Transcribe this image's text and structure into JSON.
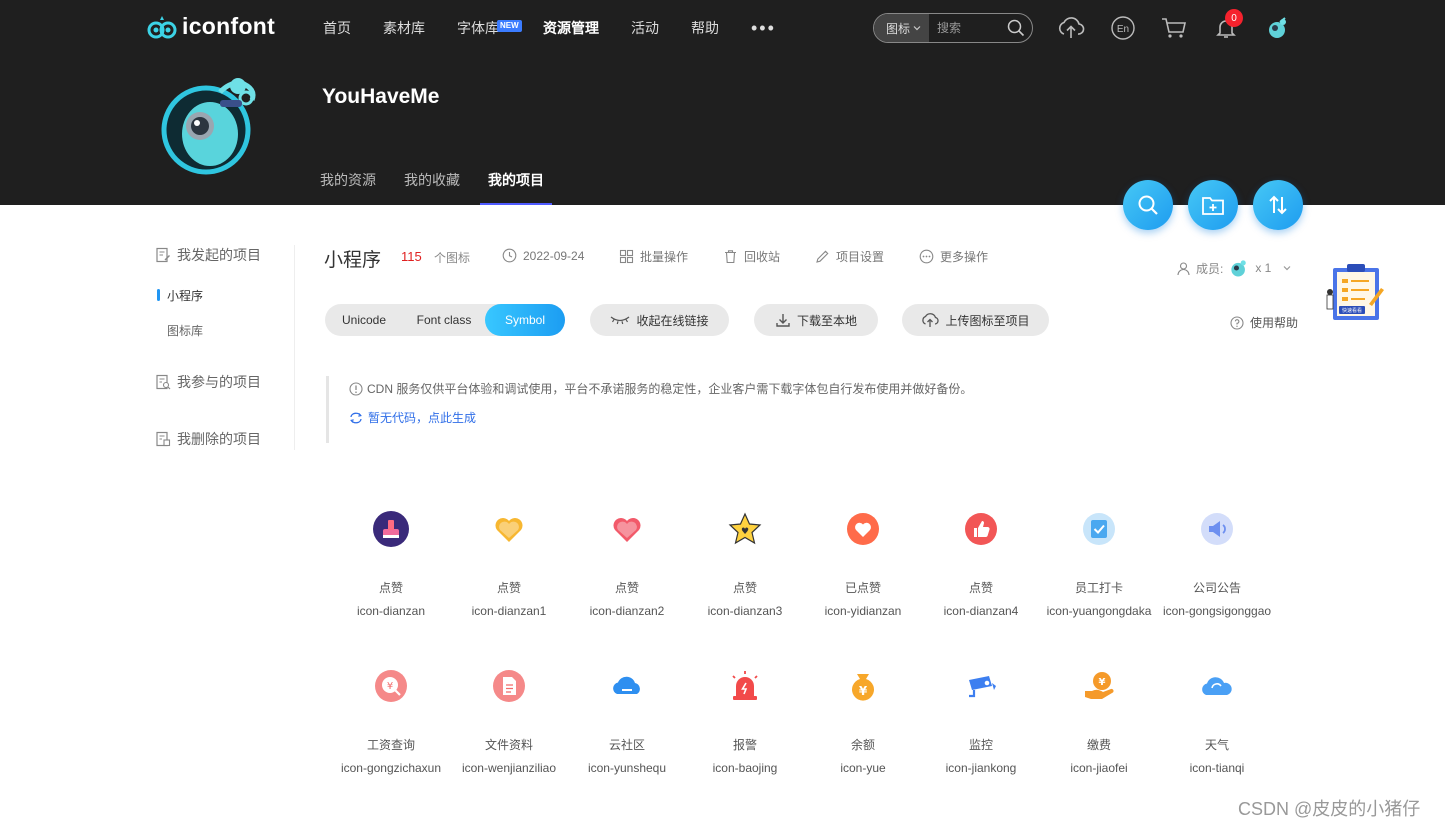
{
  "header": {
    "logo_text": "iconfont",
    "nav": [
      {
        "label": "首页"
      },
      {
        "label": "素材库"
      },
      {
        "label": "字体库",
        "badge": "NEW"
      },
      {
        "label": "资源管理"
      },
      {
        "label": "活动"
      },
      {
        "label": "帮助"
      }
    ],
    "more": "•••",
    "search": {
      "type": "图标",
      "placeholder": "搜索"
    },
    "notifications": "0"
  },
  "profile": {
    "username": "YouHaveMe",
    "tabs": [
      "我的资源",
      "我的收藏",
      "我的项目"
    ]
  },
  "sidebar": {
    "created": "我发起的项目",
    "created_items": [
      "小程序",
      "图标库"
    ],
    "joined": "我参与的项目",
    "deleted": "我删除的项目"
  },
  "project": {
    "title": "小程序",
    "count": "115",
    "count_unit": "个图标",
    "date": "2022-09-24",
    "batch": "批量操作",
    "recycle": "回收站",
    "settings": "项目设置",
    "more_ops": "更多操作",
    "members_label": "成员:",
    "members_count": "x 1",
    "help": "使用帮助",
    "art_label": "快速看看"
  },
  "modes": [
    "Unicode",
    "Font class",
    "Symbol"
  ],
  "actions": {
    "collapse": "收起在线链接",
    "download": "下载至本地",
    "upload": "上传图标至项目"
  },
  "notice": {
    "text": "CDN 服务仅供平台体验和调试使用，平台不承诺服务的稳定性，企业客户需下载字体包自行发布使用并做好备份。",
    "link": "暂无代码，点此生成"
  },
  "icons": [
    {
      "name": "点赞",
      "code": "icon-dianzan",
      "icon": "like-bag-icon",
      "color": "#3a2a7a"
    },
    {
      "name": "点赞",
      "code": "icon-dianzan1",
      "icon": "heart-icon",
      "color": "#f7b731"
    },
    {
      "name": "点赞",
      "code": "icon-dianzan2",
      "icon": "heart-icon",
      "color": "#f25a6a"
    },
    {
      "name": "点赞",
      "code": "icon-dianzan3",
      "icon": "star-icon",
      "color": "#ffd23f"
    },
    {
      "name": "已点赞",
      "code": "icon-yidianzan",
      "icon": "heart-circle-icon",
      "color": "#ff6b4a"
    },
    {
      "name": "点赞",
      "code": "icon-dianzan4",
      "icon": "thumbs-up-icon",
      "color": "#f25656"
    },
    {
      "name": "员工打卡",
      "code": "icon-yuangongdaka",
      "icon": "check-in-icon",
      "color": "#4aa8f0"
    },
    {
      "name": "公司公告",
      "code": "icon-gongsigonggao",
      "icon": "announcement-icon",
      "color": "#6d8ff0"
    },
    {
      "name": "工资查询",
      "code": "icon-gongzichaxun",
      "icon": "salary-query-icon",
      "color": "#f26b6b"
    },
    {
      "name": "文件资料",
      "code": "icon-wenjianziliao",
      "icon": "document-icon",
      "color": "#f26b6b"
    },
    {
      "name": "云社区",
      "code": "icon-yunshequ",
      "icon": "cloud-icon",
      "color": "#2e8ff0"
    },
    {
      "name": "报警",
      "code": "icon-baojing",
      "icon": "alarm-icon",
      "color": "#f24a4a"
    },
    {
      "name": "余额",
      "code": "icon-yue",
      "icon": "money-bag-icon",
      "color": "#f7a72a"
    },
    {
      "name": "监控",
      "code": "icon-jiankong",
      "icon": "camera-icon",
      "color": "#3d7ff0"
    },
    {
      "name": "缴费",
      "code": "icon-jiaofei",
      "icon": "payment-icon",
      "color": "#f59a2a"
    },
    {
      "name": "天气",
      "code": "icon-tianqi",
      "icon": "weather-cloud-icon",
      "color": "#4aa0f5"
    }
  ],
  "watermark": "CSDN @皮皮的小猪仔"
}
